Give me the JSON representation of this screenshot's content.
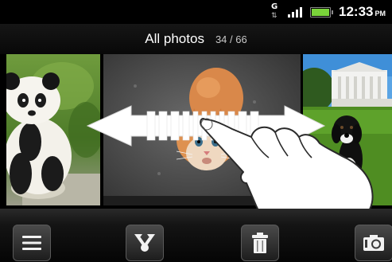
{
  "status_bar": {
    "network_type": "G",
    "clock_time": "12:33",
    "clock_ampm": "PM",
    "icons": [
      "data-transfer-icon",
      "signal-strength-icon",
      "battery-icon"
    ],
    "battery_color": "#7ad33a"
  },
  "header": {
    "title": "All photos",
    "counter": "34 / 66"
  },
  "photos": [
    {
      "name": "panda-photo"
    },
    {
      "name": "kitten-photo"
    },
    {
      "name": "dog-white-house-photo"
    }
  ],
  "gesture": {
    "icons": [
      "swipe-arrow-icon",
      "hand-pointer-icon"
    ]
  },
  "toolbar": {
    "icons": [
      "menu-icon",
      "share-icon",
      "trash-icon",
      "camera-icon"
    ]
  }
}
